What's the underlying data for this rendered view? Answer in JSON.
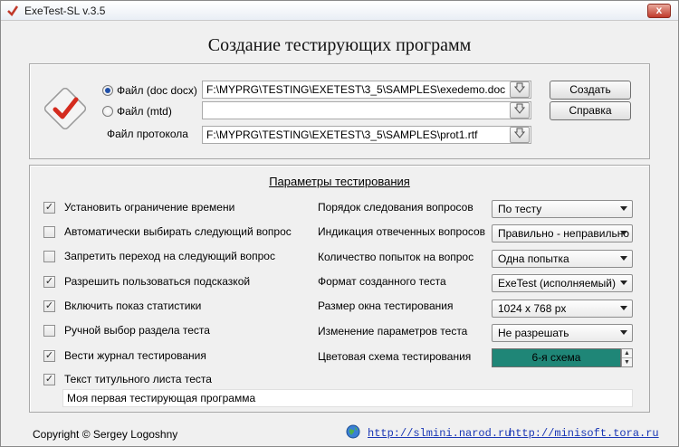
{
  "window": {
    "title": "ExeTest-SL  v.3.5",
    "close_label": "x"
  },
  "header": {
    "title": "Создание тестирующих программ"
  },
  "files": {
    "doc": {
      "label": "Файл (doc docx)",
      "value": "F:\\MYPRG\\TESTING\\EXETEST\\3_5\\SAMPLES\\exedemo.doc",
      "selected": true
    },
    "mtd": {
      "label": "Файл (mtd)",
      "value": "",
      "selected": false
    },
    "protocol": {
      "label": "Файл протокола",
      "value": "F:\\MYPRG\\TESTING\\EXETEST\\3_5\\SAMPLES\\prot1.rtf"
    }
  },
  "actions": {
    "create_label": "Создать",
    "help_label": "Справка"
  },
  "params": {
    "title": "Параметры тестирования",
    "options": [
      {
        "label": "Установить ограничение времени",
        "checked": true
      },
      {
        "label": "Автоматически выбирать следующий вопрос",
        "checked": false
      },
      {
        "label": "Запретить переход на следующий вопрос",
        "checked": false
      },
      {
        "label": "Разрешить пользоваться подсказкой",
        "checked": true
      },
      {
        "label": "Включить показ статистики",
        "checked": true
      },
      {
        "label": "Ручной выбор раздела теста",
        "checked": false
      },
      {
        "label": "Вести журнал тестирования",
        "checked": true
      },
      {
        "label": "Текст титульного листа теста",
        "checked": true
      }
    ],
    "settings": [
      {
        "label": "Порядок следования вопросов",
        "value": "По тесту"
      },
      {
        "label": "Индикация отвеченных вопросов",
        "value": "Правильно - неправильно"
      },
      {
        "label": "Количество попыток на вопрос",
        "value": "Одна попытка"
      },
      {
        "label": "Формат созданного теста",
        "value": "ExeTest (исполняемый)"
      },
      {
        "label": "Размер окна тестирования",
        "value": "1024 x 768 px"
      },
      {
        "label": "Изменение параметров теста",
        "value": "Не разрешать"
      }
    ],
    "color_scheme": {
      "label": "Цветовая схема тестирования",
      "value": "6-я схема",
      "color": "#1f8677"
    },
    "title_page_text": "Моя первая тестирующая программа"
  },
  "footer": {
    "copyright": "Copyright © Sergey Logoshny",
    "link1": "http://slmini.narod.ru",
    "link2": "http://minisoft.tora.ru"
  }
}
